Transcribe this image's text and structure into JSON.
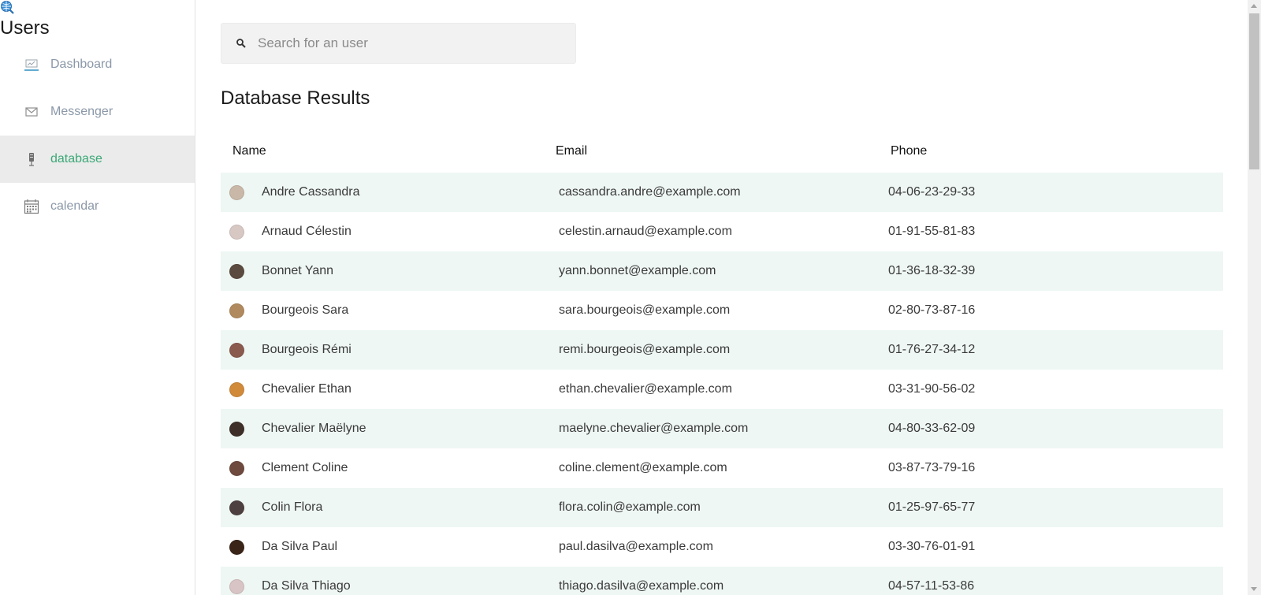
{
  "sidebar": {
    "logo_icon": "globe-search-icon",
    "title": "Users",
    "items": [
      {
        "label": "Dashboard",
        "icon": "dashboard-icon",
        "active": false
      },
      {
        "label": "Messenger",
        "icon": "envelope-icon",
        "active": false
      },
      {
        "label": "database",
        "icon": "database-icon",
        "active": true
      },
      {
        "label": "calendar",
        "icon": "calendar-icon",
        "active": false
      }
    ]
  },
  "search": {
    "placeholder": "Search for an user",
    "value": ""
  },
  "results": {
    "title": "Database Results",
    "columns": {
      "name": "Name",
      "email": "Email",
      "phone": "Phone"
    },
    "rows": [
      {
        "name": "Andre Cassandra",
        "email": "cassandra.andre@example.com",
        "phone": "04-06-23-29-33",
        "avatar_color": "#c9b8a8"
      },
      {
        "name": "Arnaud Célestin",
        "email": "celestin.arnaud@example.com",
        "phone": "01-91-55-81-83",
        "avatar_color": "#d8c8c4"
      },
      {
        "name": "Bonnet Yann",
        "email": "yann.bonnet@example.com",
        "phone": "01-36-18-32-39",
        "avatar_color": "#5b4a3f"
      },
      {
        "name": "Bourgeois Sara",
        "email": "sara.bourgeois@example.com",
        "phone": "02-80-73-87-16",
        "avatar_color": "#b08a5e"
      },
      {
        "name": "Bourgeois Rémi",
        "email": "remi.bourgeois@example.com",
        "phone": "01-76-27-34-12",
        "avatar_color": "#8a5a4e"
      },
      {
        "name": "Chevalier Ethan",
        "email": "ethan.chevalier@example.com",
        "phone": "03-31-90-56-02",
        "avatar_color": "#d08a3a"
      },
      {
        "name": "Chevalier Maëlyne",
        "email": "maelyne.chevalier@example.com",
        "phone": "04-80-33-62-09",
        "avatar_color": "#3e2f28"
      },
      {
        "name": "Clement Coline",
        "email": "coline.clement@example.com",
        "phone": "03-87-73-79-16",
        "avatar_color": "#6e4a3e"
      },
      {
        "name": "Colin Flora",
        "email": "flora.colin@example.com",
        "phone": "01-25-97-65-77",
        "avatar_color": "#4e4040"
      },
      {
        "name": "Da Silva Paul",
        "email": "paul.dasilva@example.com",
        "phone": "03-30-76-01-91",
        "avatar_color": "#3a2418"
      },
      {
        "name": "Da Silva Thiago",
        "email": "thiago.dasilva@example.com",
        "phone": "04-57-11-53-86",
        "avatar_color": "#d8c4c4"
      }
    ]
  },
  "colors": {
    "accent": "#3aa876",
    "row_stripe": "#eef7f3",
    "nav_inactive": "#8b98a8",
    "nav_active_bg": "#ebebeb"
  }
}
